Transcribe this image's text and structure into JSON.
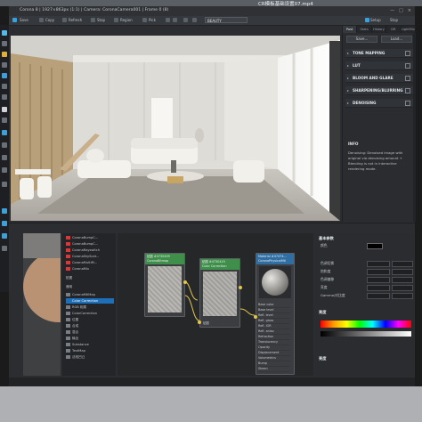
{
  "video_filename": "CR模板基础设置07.mp4",
  "window": {
    "title": "Corona 8 | 1927×863px (1:1) | Camera: CoronaCamera001 | Frame 0 (8)",
    "controls": [
      "—",
      "□",
      "×"
    ]
  },
  "toolbar": {
    "items": [
      "Save",
      "Copy",
      "Refresh",
      "Stop",
      "Region",
      "Pick"
    ],
    "channel_select": "BEAUTY",
    "right_items": [
      "Setup",
      "Stop"
    ]
  },
  "right_panel": {
    "tabs": [
      "Post",
      "Stats",
      "History",
      "DR",
      "LightMix"
    ],
    "buttons": [
      "Save...",
      "Load..."
    ],
    "sections": [
      "TONE MAPPING",
      "LUT",
      "BLOOM AND GLARE",
      "SHARPENING/BLURRING",
      "DENOISING"
    ],
    "info_title": "INFO",
    "info_text": "Denoising: Denoised image with original via denoising amount + Blending is not in interactive rendering mode."
  },
  "node_list": {
    "items": [
      {
        "label": "CoronaBumpC...",
        "color": "#d23b3b"
      },
      {
        "label": "CoronaBumpC...",
        "color": "#d23b3b"
      },
      {
        "label": "CoronaRayswitch",
        "color": "#d23b3b"
      },
      {
        "label": "CoronaSkyScat...",
        "color": "#d23b3b"
      },
      {
        "label": "CoronaMultiM...",
        "color": "#d23b3b"
      },
      {
        "label": "CoronaMix",
        "color": "#d23b3b"
      },
      {
        "label": "贴图",
        "color": "#2b2d30"
      },
      {
        "label": "通用",
        "color": "#2b2d30"
      },
      {
        "label": "CoronaMtlMap",
        "color": "#7a7f86"
      },
      {
        "label": "Color Correction",
        "color": "#1d6fb8"
      },
      {
        "label": "RGB 相乘",
        "color": "#7a7f86"
      },
      {
        "label": "ColorCorrection",
        "color": "#7a7f86"
      },
      {
        "label": "位图",
        "color": "#7a7f86"
      },
      {
        "label": "合成",
        "color": "#7a7f86"
      },
      {
        "label": "混合",
        "color": "#7a7f86"
      },
      {
        "label": "输出",
        "color": "#7a7f86"
      },
      {
        "label": "Substance",
        "color": "#7a7f86"
      },
      {
        "label": "TextMap",
        "color": "#7a7f86"
      },
      {
        "label": "法线凹凸",
        "color": "#7a7f86"
      }
    ]
  },
  "nodes": {
    "bitmap": {
      "title1": "贴图 #4730409",
      "title2": "CoronaBitmap"
    },
    "colorcorr": {
      "title1": "贴图 #4730419",
      "title2": "Color Correction",
      "input_label": "贴图"
    },
    "material": {
      "title1": "Material #47474...",
      "title2": "CoronaPhysicalMtl",
      "slots": [
        "Base color",
        "Base level",
        "Refl. level",
        "Refl. gloss",
        "Refl. IOR",
        "Refl. aniso",
        "Refraction",
        "Translucency",
        "Opacity",
        "Displacement",
        "Volumetrics",
        "Bump",
        "Sheen"
      ]
    }
  },
  "properties": {
    "header": "基本参数",
    "color_label": "颜色",
    "rows": [
      {
        "label": "色调切换",
        "v1": "",
        "v2": ""
      },
      {
        "label": "饱和度",
        "v1": "",
        "v2": ""
      },
      {
        "label": "色调偏移",
        "v1": "",
        "v2": ""
      },
      {
        "label": "亮度",
        "v1": "",
        "v2": ""
      },
      {
        "label": "Gamma/对比度",
        "v1": "",
        "v2": ""
      }
    ],
    "section2": "亮度",
    "section3": "亮度"
  }
}
